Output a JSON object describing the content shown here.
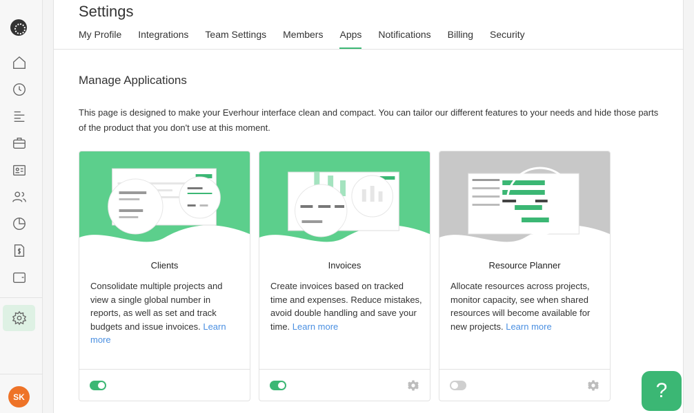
{
  "user": {
    "initials": "SK"
  },
  "header": {
    "title": "Settings",
    "tabs": [
      {
        "label": "My Profile"
      },
      {
        "label": "Integrations"
      },
      {
        "label": "Team Settings"
      },
      {
        "label": "Members"
      },
      {
        "label": "Apps"
      },
      {
        "label": "Notifications"
      },
      {
        "label": "Billing"
      },
      {
        "label": "Security"
      }
    ],
    "active_tab": "Apps"
  },
  "section": {
    "title": "Manage Applications",
    "description": "This page is designed to make your Everhour interface clean and compact. You can tailor our different features to your needs and hide those parts of the product that you don't use at this moment."
  },
  "cards": [
    {
      "title": "Clients",
      "text": "Consolidate multiple projects and view a single global number in reports, as well as set and track budgets and issue invoices.",
      "learn": "Learn more",
      "enabled": true,
      "accent": "#5ccf8c"
    },
    {
      "title": "Invoices",
      "text": "Create invoices based on tracked time and expenses. Reduce mistakes, avoid double handling and save your time.",
      "learn": "Learn more",
      "enabled": true,
      "accent": "#5ccf8c"
    },
    {
      "title": "Resource Planner",
      "text": "Allocate resources across projects, monitor capacity, see when shared resources will become available for new projects.",
      "learn": "Learn more",
      "enabled": false,
      "accent": "#c8c8c8"
    }
  ],
  "help": {
    "label": "?"
  },
  "colors": {
    "brand_green": "#3bb774",
    "avatar": "#ee7328",
    "link": "#4a8fe1"
  }
}
